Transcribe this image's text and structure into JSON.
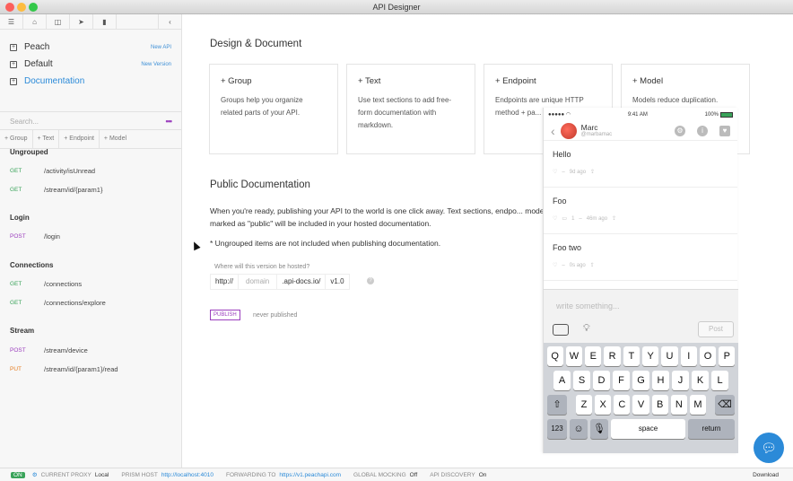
{
  "window": {
    "title": "API Designer"
  },
  "sidebar": {
    "docs": [
      {
        "label": "Peach",
        "action": "New API"
      },
      {
        "label": "Default",
        "action": "New Version"
      },
      {
        "label": "Documentation",
        "action": ""
      }
    ],
    "search_placeholder": "Search...",
    "add_buttons": [
      "+ Group",
      "+ Text",
      "+ Endpoint",
      "+ Model"
    ],
    "groups": [
      {
        "name": "Ungrouped",
        "endpoints": [
          {
            "method": "GET",
            "path": "/activity/isUnread"
          },
          {
            "method": "GET",
            "path": "/stream/id/{param1}"
          }
        ]
      },
      {
        "name": "Login",
        "endpoints": [
          {
            "method": "POST",
            "path": "/login"
          }
        ]
      },
      {
        "name": "Connections",
        "endpoints": [
          {
            "method": "GET",
            "path": "/connections"
          },
          {
            "method": "GET",
            "path": "/connections/explore"
          }
        ]
      },
      {
        "name": "Stream",
        "endpoints": [
          {
            "method": "POST",
            "path": "/stream/device"
          },
          {
            "method": "PUT",
            "path": "/stream/id/{param1}/read"
          }
        ]
      }
    ]
  },
  "main": {
    "design_title": "Design & Document",
    "cards": [
      {
        "title": "+ Group",
        "desc": "Groups help you organize related parts of your API."
      },
      {
        "title": "+ Text",
        "desc": "Use text sections to add free-form documentation with markdown."
      },
      {
        "title": "+ Endpoint",
        "desc": "Endpoints are unique HTTP method + pa... your API."
      },
      {
        "title": "+ Model",
        "desc": "Models reduce duplication."
      }
    ],
    "public_title": "Public Documentation",
    "public_desc": "When you're ready, publishing your API to the world is one click away. Text sections, endpo... models marked as \"public\" will be included in your hosted documentation.",
    "note": "* Ungrouped items are not included when publishing documentation.",
    "host_question": "Where will this version be hosted?",
    "host": {
      "scheme": "http://",
      "domain_placeholder": "domain",
      "suffix": ".api-docs.io/",
      "version": "v1.0"
    },
    "publish_label": "PUBLISH",
    "publish_status": "never published"
  },
  "phone": {
    "status_time": "9:41 AM",
    "battery": "100%",
    "user_name": "Marc",
    "user_handle": "@marbamac",
    "posts": [
      {
        "text": "Hello",
        "meta": "9d ago",
        "comments": ""
      },
      {
        "text": "Foo",
        "meta": "46m ago",
        "comments": "1"
      },
      {
        "text": "Foo two",
        "meta": "0s ago",
        "comments": ""
      }
    ],
    "compose_placeholder": "write something...",
    "post_button": "Post",
    "keyboard": {
      "row1": [
        "Q",
        "W",
        "E",
        "R",
        "T",
        "Y",
        "U",
        "I",
        "O",
        "P"
      ],
      "row2": [
        "A",
        "S",
        "D",
        "F",
        "G",
        "H",
        "J",
        "K",
        "L"
      ],
      "row3": [
        "Z",
        "X",
        "C",
        "V",
        "B",
        "N",
        "M"
      ],
      "num": "123",
      "space": "space",
      "return": "return"
    }
  },
  "footer": {
    "on": "ON",
    "proxy_label": "CURRENT PROXY",
    "proxy_value": "Local",
    "prism_label": "PRISM HOST",
    "prism_value": "http://localhost:4010",
    "forward_label": "FORWARDING TO",
    "forward_value": "https://v1.peachapi.com",
    "mocking_label": "GLOBAL MOCKING",
    "mocking_value": "Off",
    "discovery_label": "API DISCOVERY",
    "discovery_value": "On",
    "download": "Download"
  }
}
